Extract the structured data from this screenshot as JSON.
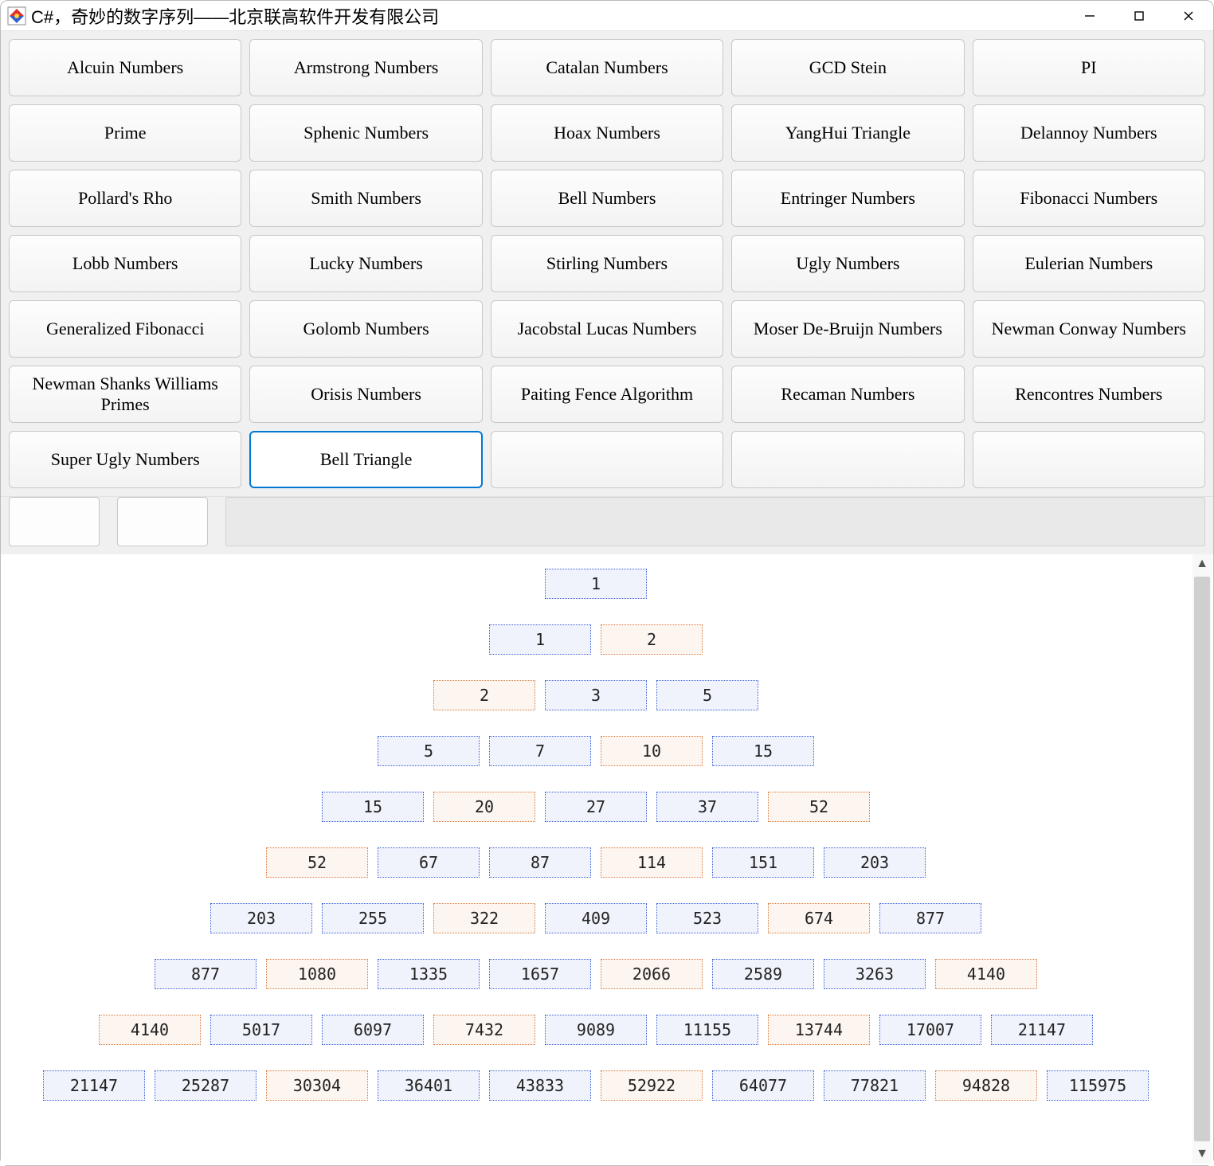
{
  "window": {
    "title": "C#，奇妙的数字序列——北京联高软件开发有限公司"
  },
  "buttons": {
    "b00": "Alcuin Numbers",
    "b01": "Armstrong Numbers",
    "b02": "Catalan Numbers",
    "b03": "GCD Stein",
    "b04": "PI",
    "b10": "Prime",
    "b11": "Sphenic Numbers",
    "b12": "Hoax Numbers",
    "b13": "YangHui Triangle",
    "b14": "Delannoy Numbers",
    "b20": "Pollard's Rho",
    "b21": "Smith Numbers",
    "b22": "Bell Numbers",
    "b23": "Entringer Numbers",
    "b24": "Fibonacci Numbers",
    "b30": "Lobb Numbers",
    "b31": "Lucky Numbers",
    "b32": "Stirling Numbers",
    "b33": "Ugly Numbers",
    "b34": "Eulerian Numbers",
    "b40": "Generalized Fibonacci",
    "b41": "Golomb Numbers",
    "b42": "Jacobstal Lucas Numbers",
    "b43": "Moser De-Bruijn Numbers",
    "b44": "Newman Conway Numbers",
    "b50": "Newman Shanks Williams Primes",
    "b51": "Orisis Numbers",
    "b52": "Paiting Fence Algorithm",
    "b53": "Recaman Numbers",
    "b54": "Rencontres Numbers",
    "b60": "Super Ugly Numbers",
    "b61": "Bell Triangle",
    "b62": "",
    "b63": "",
    "b64": ""
  },
  "selected": "b61",
  "triangle": [
    [
      {
        "v": "1",
        "c": 0
      }
    ],
    [
      {
        "v": "1",
        "c": 0
      },
      {
        "v": "2",
        "c": 1
      }
    ],
    [
      {
        "v": "2",
        "c": 1
      },
      {
        "v": "3",
        "c": 0
      },
      {
        "v": "5",
        "c": 0
      }
    ],
    [
      {
        "v": "5",
        "c": 0
      },
      {
        "v": "7",
        "c": 0
      },
      {
        "v": "10",
        "c": 1
      },
      {
        "v": "15",
        "c": 0
      }
    ],
    [
      {
        "v": "15",
        "c": 0
      },
      {
        "v": "20",
        "c": 1
      },
      {
        "v": "27",
        "c": 0
      },
      {
        "v": "37",
        "c": 0
      },
      {
        "v": "52",
        "c": 1
      }
    ],
    [
      {
        "v": "52",
        "c": 1
      },
      {
        "v": "67",
        "c": 0
      },
      {
        "v": "87",
        "c": 0
      },
      {
        "v": "114",
        "c": 1
      },
      {
        "v": "151",
        "c": 0
      },
      {
        "v": "203",
        "c": 0
      }
    ],
    [
      {
        "v": "203",
        "c": 0
      },
      {
        "v": "255",
        "c": 0
      },
      {
        "v": "322",
        "c": 1
      },
      {
        "v": "409",
        "c": 0
      },
      {
        "v": "523",
        "c": 0
      },
      {
        "v": "674",
        "c": 1
      },
      {
        "v": "877",
        "c": 0
      }
    ],
    [
      {
        "v": "877",
        "c": 0
      },
      {
        "v": "1080",
        "c": 1
      },
      {
        "v": "1335",
        "c": 0
      },
      {
        "v": "1657",
        "c": 0
      },
      {
        "v": "2066",
        "c": 1
      },
      {
        "v": "2589",
        "c": 0
      },
      {
        "v": "3263",
        "c": 0
      },
      {
        "v": "4140",
        "c": 1
      }
    ],
    [
      {
        "v": "4140",
        "c": 1
      },
      {
        "v": "5017",
        "c": 0
      },
      {
        "v": "6097",
        "c": 0
      },
      {
        "v": "7432",
        "c": 1
      },
      {
        "v": "9089",
        "c": 0
      },
      {
        "v": "11155",
        "c": 0
      },
      {
        "v": "13744",
        "c": 1
      },
      {
        "v": "17007",
        "c": 0
      },
      {
        "v": "21147",
        "c": 0
      }
    ],
    [
      {
        "v": "21147",
        "c": 0
      },
      {
        "v": "25287",
        "c": 0
      },
      {
        "v": "30304",
        "c": 1
      },
      {
        "v": "36401",
        "c": 0
      },
      {
        "v": "43833",
        "c": 0
      },
      {
        "v": "52922",
        "c": 1
      },
      {
        "v": "64077",
        "c": 0
      },
      {
        "v": "77821",
        "c": 0
      },
      {
        "v": "94828",
        "c": 1
      },
      {
        "v": "115975",
        "c": 0
      }
    ]
  ]
}
